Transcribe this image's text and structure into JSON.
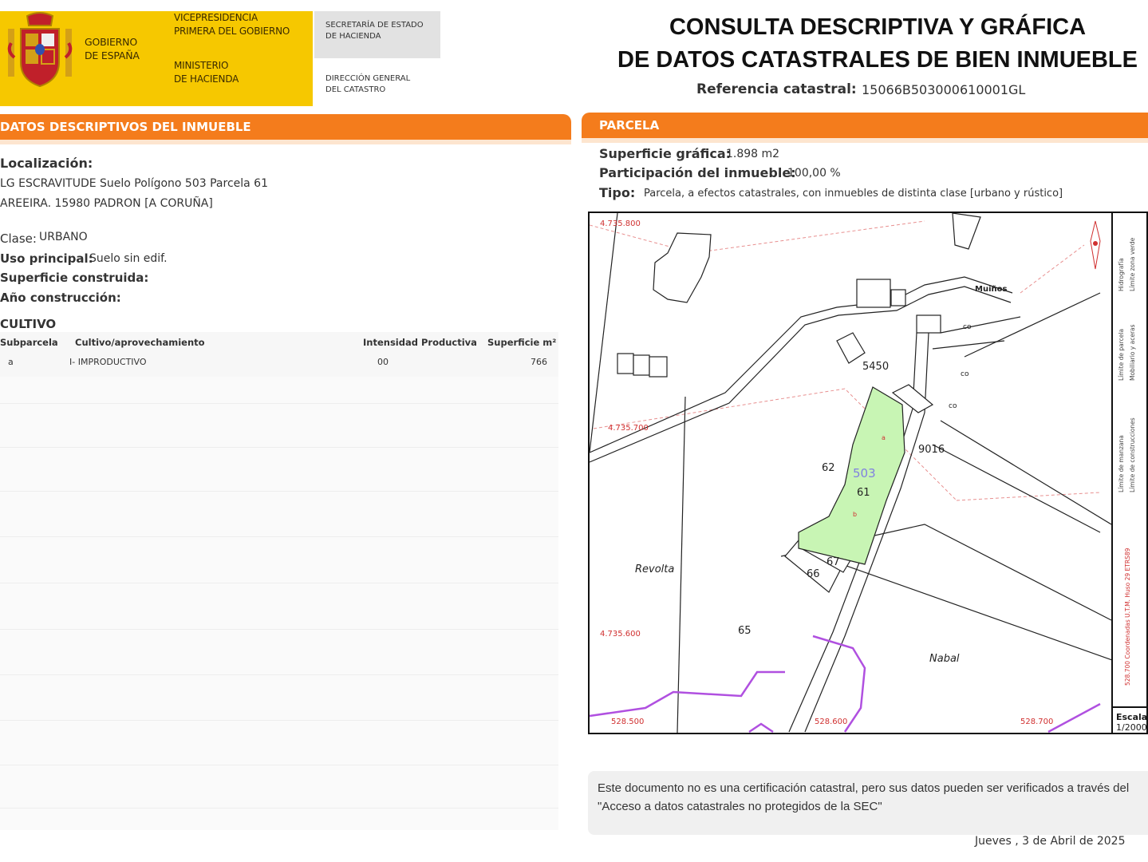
{
  "header": {
    "gov_name": "GOBIERNO\nDE ESPAÑA",
    "vicepresidency": "VICEPRESIDENCIA\nPRIMERA DEL GOBIERNO",
    "ministry": "MINISTERIO\nDE HACIENDA",
    "secretaria": "SECRETARÍA DE ESTADO\nDE HACIENDA",
    "direccion": "DIRECCIÓN GENERAL\nDEL CATASTRO",
    "title": "CONSULTA DESCRIPTIVA Y GRÁFICA\nDE DATOS CATASTRALES DE BIEN INMUEBLE",
    "ref_label": "Referencia catastral:",
    "ref_value": "15066B503000610001GL"
  },
  "left": {
    "section_title": "DATOS DESCRIPTIVOS DEL INMUEBLE",
    "localizacion_label": "Localización:",
    "address_line1": "LG ESCRAVITUDE  Suelo Polígono 503 Parcela 61",
    "address_line2": "AREEIRA. 15980 PADRON [A CORUÑA]",
    "clase_label": "Clase:",
    "clase_value": "URBANO",
    "uso_label": "Uso principal:",
    "uso_value": "Suelo sin edif.",
    "superficie_construida_label": "Superficie construida:",
    "anio_label": "Año construcción:",
    "cultivo_title": "CULTIVO",
    "cultivo": {
      "headers": [
        "Subparcela",
        "Cultivo/aprovechamiento",
        "Intensidad Productiva",
        "Superficie m²"
      ],
      "rows": [
        {
          "subparcela": "a",
          "cultivo": "I- IMPRODUCTIVO",
          "intensidad": "00",
          "superficie": "766"
        }
      ]
    }
  },
  "right": {
    "section_title": "PARCELA",
    "superficie_label": "Superficie gráfica:",
    "superficie_value": "1.898 m2",
    "participacion_label": "Participación del inmueble:",
    "participacion_value": "100,00 %",
    "tipo_label": "Tipo:",
    "tipo_value": "Parcela, a efectos catastrales, con inmuebles de distinta clase [urbano y rústico]"
  },
  "map": {
    "coords": {
      "y1": "4.735.800",
      "y2": "4.735.700",
      "y3": "4.735.600",
      "x1": "528.500",
      "x2": "528.600",
      "x3": "528.700"
    },
    "labels": {
      "muinos": "Muiños",
      "revolta": "Revolta",
      "nabal": "Nabal",
      "p5450": "5450",
      "p9016": "9016",
      "p62": "62",
      "p503": "503",
      "p61": "61",
      "p67": "67",
      "p66": "66",
      "p65": "65",
      "co1": "co",
      "co2": "co",
      "co3": "co",
      "sub_a": "a",
      "sub_b": "b"
    },
    "legend": {
      "hidrografia": "Hidrografía",
      "limite_zona_verde": "Límite zona verde",
      "limite_parcela": "Límite de parcela",
      "mobiliario": "Mobiliario y aceras",
      "limite_manzana": "Límite de manzana",
      "limite_construcciones": "Límite de construcciones",
      "coords_note": "528.700 Coordenadas U.T.M. Huso 29 ETRS89"
    },
    "scale_label": "Escala:",
    "scale_value": "1/2000",
    "colors": {
      "parcel_fill": "#c8f5b4",
      "coord_text": "#d03030",
      "purple_line": "#b050e0",
      "dashed_limit": "#e89090"
    }
  },
  "notice": "Este documento no es una certificación catastral, pero sus datos pueden ser verificados a través del \"Acceso a datos catastrales no protegidos de la SEC\"",
  "date": "Jueves , 3 de Abril de 2025",
  "colors": {
    "orange": "#f47c1c",
    "yellow": "#f6c800",
    "grey": "#e2e2e2"
  }
}
